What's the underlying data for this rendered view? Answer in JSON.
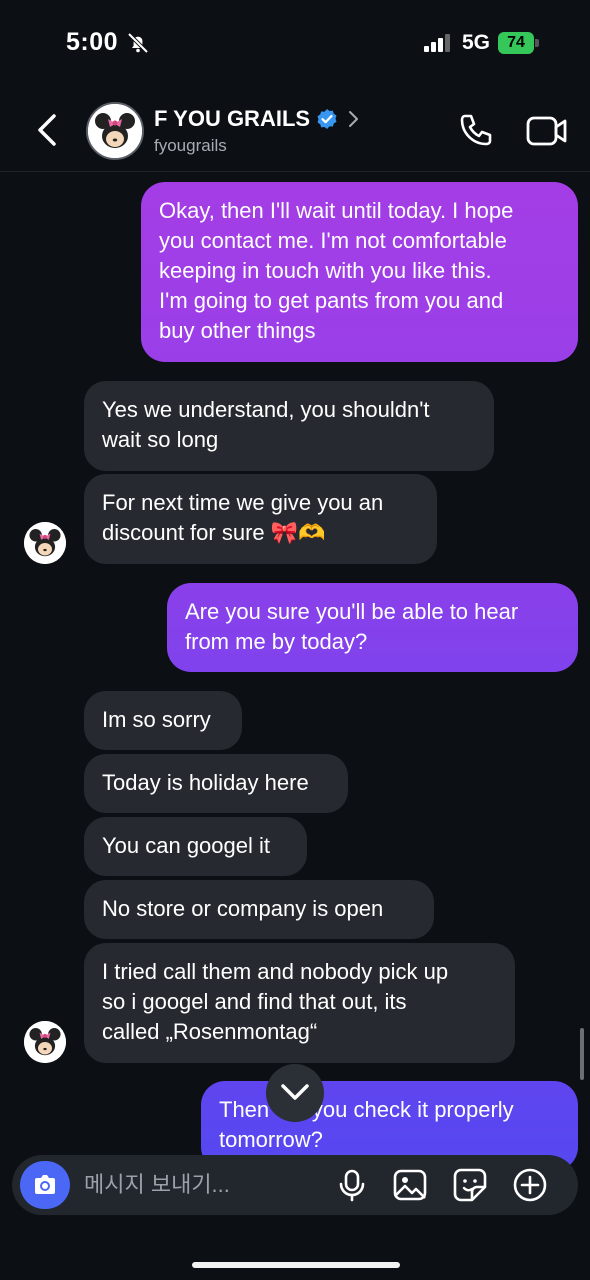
{
  "status_bar": {
    "time": "5:00",
    "network": "5G",
    "battery": "74"
  },
  "header": {
    "title": "F YOU GRAILS",
    "handle": "fyougrails"
  },
  "messages": [
    {
      "text": "Okay, then I'll wait until today. I hope\nyou contact me. I'm not comfortable\nkeeping in touch with you like this.\nI'm going to get pants from you and\nbuy other things"
    },
    {
      "text": "Yes we understand, you shouldn't\nwait so long"
    },
    {
      "text": "For next time we give you an\ndiscount for sure 🎀🫶"
    },
    {
      "text": "Are you sure you'll be able to hear\nfrom me by today?"
    },
    {
      "text": "Im so sorry"
    },
    {
      "text": "Today is holiday here"
    },
    {
      "text": "You can googel it"
    },
    {
      "text": "No store or company is open"
    },
    {
      "text": "I tried call them and nobody pick up\nso i googel and find that out, its\ncalled „Rosenmontag“"
    },
    {
      "text": "Then will you check it properly\ntomorrow?"
    }
  ],
  "composer": {
    "placeholder": "메시지 보내기..."
  },
  "colors": {
    "outgoing_top": "#a43de6",
    "outgoing_bottom": "#5a45f0",
    "incoming": "#262a30",
    "accent": "#4b67f5",
    "verified": "#3797f0"
  },
  "icons": [
    "bell-off-icon",
    "signal-icon",
    "battery-icon",
    "back-icon",
    "verified-icon",
    "chevron-right-icon",
    "phone-icon",
    "video-icon",
    "chevron-down-icon",
    "camera-icon",
    "microphone-icon",
    "gallery-icon",
    "sticker-icon",
    "plus-icon"
  ]
}
